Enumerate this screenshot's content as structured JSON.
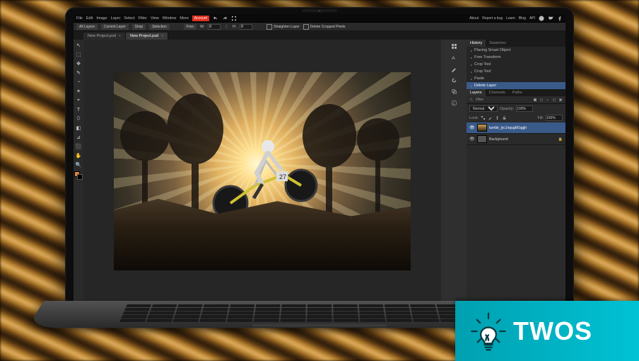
{
  "menu": {
    "items": [
      "File",
      "Edit",
      "Image",
      "Layer",
      "Select",
      "Filter",
      "View",
      "Window",
      "More"
    ],
    "account": "Account",
    "right": [
      "About",
      "Report a bug",
      "Learn",
      "Blog",
      "API"
    ]
  },
  "options": {
    "scope": [
      "All Layers",
      "Current Layer",
      "Shop",
      "Selection"
    ],
    "free": "Free",
    "w_label": "W:",
    "w_value": "0",
    "h_label": "H:",
    "h_value": "0",
    "straighten": "Straighten Layer",
    "delete_cropped": "Delete Cropped Pixels"
  },
  "tabs": [
    {
      "label": "New Project.psd",
      "active": false
    },
    {
      "label": "New Project.psd",
      "active": true
    }
  ],
  "tools": [
    "↖",
    "⬚",
    "✥",
    "✎",
    "◔",
    "✶",
    "⌖",
    "T",
    "⬯",
    "◧",
    "⊿",
    "⬛",
    "✋",
    "🔍"
  ],
  "swatch": {
    "fg": "#e08040",
    "bg": "#000000"
  },
  "right_dock_icons": [
    "swatches",
    "character",
    "brush",
    "history",
    "clone",
    "info"
  ],
  "history": {
    "tabs": [
      "History",
      "Swatches"
    ],
    "items": [
      {
        "label": "Placing Smart Object",
        "sel": false
      },
      {
        "label": "Free Transform",
        "sel": false
      },
      {
        "label": "Crop Tool",
        "sel": false
      },
      {
        "label": "Crop Tool",
        "sel": false
      },
      {
        "label": "Paste",
        "sel": false
      },
      {
        "label": "Delete Layer",
        "sel": true
      }
    ]
  },
  "layers_panel": {
    "tabs": [
      "Layers",
      "Channels",
      "Paths"
    ],
    "filter_label": "Filter",
    "blend": "Normal",
    "opacity_label": "Opacity:",
    "opacity": "100%",
    "lock_label": "Lock:",
    "fill_label": "Fill:",
    "fill": "100%",
    "layers": [
      {
        "name": "tumblr_lyc1nqugM1qgjh",
        "selected": true,
        "visible": true,
        "locked": false,
        "thumb": "img"
      },
      {
        "name": "Background",
        "selected": false,
        "visible": true,
        "locked": true,
        "thumb": "bg"
      }
    ]
  },
  "badge": {
    "text": "TWOS"
  }
}
